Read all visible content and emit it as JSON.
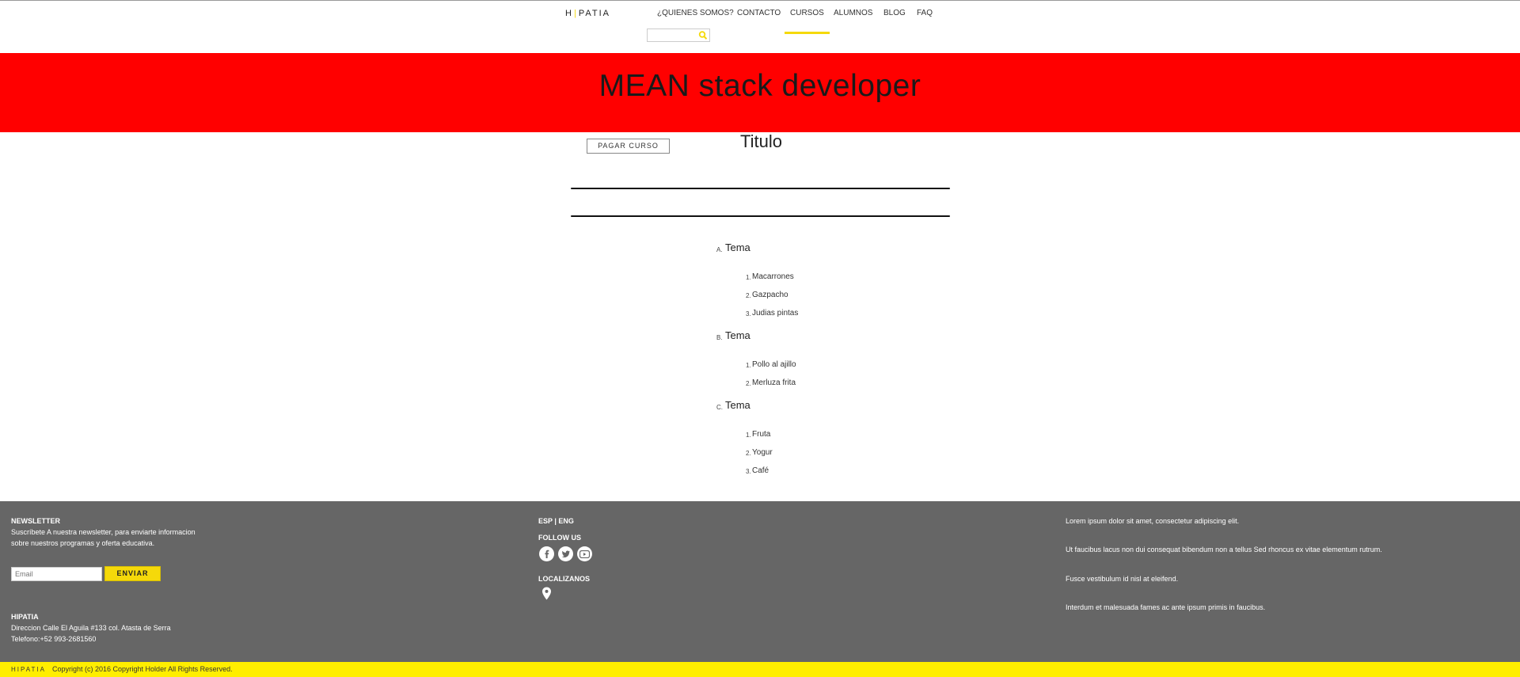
{
  "header": {
    "logo_left": "H",
    "logo_right": "PATIA",
    "nav": [
      {
        "label": "¿QUIENES SOMOS?"
      },
      {
        "label": "CONTACTO"
      },
      {
        "label": "CURSOS"
      },
      {
        "label": "ALUMNOS"
      },
      {
        "label": "BLOG"
      },
      {
        "label": "FAQ"
      }
    ],
    "active_nav": "CURSOS",
    "search_placeholder": ""
  },
  "banner": {
    "title": "MEAN stack developer",
    "background": "#ff0000"
  },
  "main": {
    "pay_button": "PAGAR CURSO",
    "heading": "Titulo",
    "temas": [
      {
        "letter": "A.",
        "name": "Tema",
        "items": [
          {
            "num": "1.",
            "text": "Macarrones"
          },
          {
            "num": "2.",
            "text": "Gazpacho"
          },
          {
            "num": "3.",
            "text": "Judias pintas"
          }
        ]
      },
      {
        "letter": "B.",
        "name": "Tema",
        "items": [
          {
            "num": "1.",
            "text": "Pollo al ajillo"
          },
          {
            "num": "2.",
            "text": "Merluza frita"
          }
        ]
      },
      {
        "letter": "C.",
        "name": "Tema",
        "items": [
          {
            "num": "1.",
            "text": "Fruta"
          },
          {
            "num": "2.",
            "text": "Yogur"
          },
          {
            "num": "3.",
            "text": "Café"
          }
        ]
      }
    ]
  },
  "footer": {
    "newsletter_title": "NEWSLETTER",
    "newsletter_text_1": "Suscríbete A nuestra newsletter, para enviarte informacion",
    "newsletter_text_2": "sobre nuestros programas y oferta educativa.",
    "email_placeholder": "Email",
    "send_button": "ENVIAR",
    "company": "HIPATIA",
    "address": "Direccion Calle El Aguila #133 col. Atasta de Serra",
    "phone": "Telefono:+52 993-2681560",
    "language": "ESP | ENG",
    "follow_us": "FOLLOW US",
    "locate": "LOCALIZANOS",
    "lorem": [
      "Lorem ipsum dolor sit amet, consectetur adipiscing elit.",
      "Ut faucibus lacus non dui consequat bibendum non a tellus Sed rhoncus ex vitae elementum rutrum.",
      "Fusce vestibulum id nisl at eleifend.",
      "Interdum et malesuada fames ac ante ipsum primis in faucibus."
    ],
    "background": "#666666"
  },
  "bottombar": {
    "logo": "HIPATIA",
    "copyright": "Copyright (c) 2016 Copyright Holder All Rights Reserved.",
    "background": "#ffee00"
  },
  "colors": {
    "accent": "#f5d90a"
  }
}
